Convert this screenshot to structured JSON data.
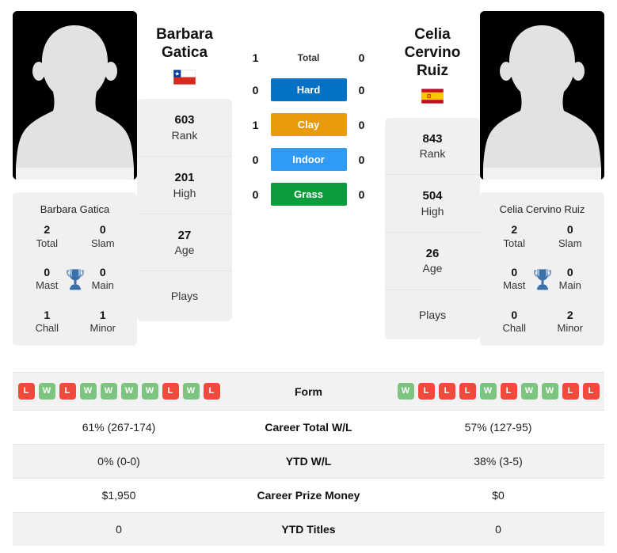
{
  "colors": {
    "hard": "#0571c4",
    "clay": "#e89b0c",
    "indoor": "#2f9bf5",
    "grass": "#0c9c3c",
    "win": "#7cc47f",
    "loss": "#ef4a3c",
    "trophy": "#3b6fa8",
    "card_bg": "#f0f0f0"
  },
  "left_player": {
    "name_line1": "Barbara",
    "name_line2": "Gatica",
    "full_name": "Barbara Gatica",
    "flag": "chile-flag-icon",
    "avatar": "player-avatar-placeholder",
    "titles": [
      {
        "value": "2",
        "label": "Total"
      },
      {
        "value": "0",
        "label": "Slam"
      },
      {
        "value": "0",
        "label": "Mast"
      },
      {
        "value": "0",
        "label": "Main"
      },
      {
        "value": "1",
        "label": "Chall"
      },
      {
        "value": "1",
        "label": "Minor"
      }
    ],
    "stats": [
      {
        "value": "603",
        "label": "Rank"
      },
      {
        "value": "201",
        "label": "High"
      },
      {
        "value": "27",
        "label": "Age"
      },
      {
        "value": "",
        "label": "Plays"
      }
    ],
    "form": [
      "L",
      "W",
      "L",
      "W",
      "W",
      "W",
      "W",
      "L",
      "W",
      "L"
    ]
  },
  "right_player": {
    "name_line1": "Celia Cervino",
    "name_line2": "Ruiz",
    "full_name": "Celia Cervino Ruiz",
    "flag": "spain-flag-icon",
    "avatar": "player-avatar-placeholder",
    "titles": [
      {
        "value": "2",
        "label": "Total"
      },
      {
        "value": "0",
        "label": "Slam"
      },
      {
        "value": "0",
        "label": "Mast"
      },
      {
        "value": "0",
        "label": "Main"
      },
      {
        "value": "0",
        "label": "Chall"
      },
      {
        "value": "2",
        "label": "Minor"
      }
    ],
    "stats": [
      {
        "value": "843",
        "label": "Rank"
      },
      {
        "value": "504",
        "label": "High"
      },
      {
        "value": "26",
        "label": "Age"
      },
      {
        "value": "",
        "label": "Plays"
      }
    ],
    "form": [
      "W",
      "L",
      "L",
      "L",
      "W",
      "L",
      "W",
      "W",
      "L",
      "L"
    ]
  },
  "head_to_head": [
    {
      "label": "Total",
      "left": "1",
      "right": "0",
      "badge": false,
      "color": ""
    },
    {
      "label": "Hard",
      "left": "0",
      "right": "0",
      "badge": true,
      "color": "#0571c4"
    },
    {
      "label": "Clay",
      "left": "1",
      "right": "0",
      "badge": true,
      "color": "#e89b0c"
    },
    {
      "label": "Indoor",
      "left": "0",
      "right": "0",
      "badge": true,
      "color": "#2f9bf5"
    },
    {
      "label": "Grass",
      "left": "0",
      "right": "0",
      "badge": true,
      "color": "#0c9c3c"
    }
  ],
  "comparison_rows": [
    {
      "label": "Form",
      "left": "",
      "right": "",
      "type": "form"
    },
    {
      "label": "Career Total W/L",
      "left": "61% (267-174)",
      "right": "57% (127-95)",
      "type": "text"
    },
    {
      "label": "YTD W/L",
      "left": "0% (0-0)",
      "right": "38% (3-5)",
      "type": "text"
    },
    {
      "label": "Career Prize Money",
      "left": "$1,950",
      "right": "$0",
      "type": "text"
    },
    {
      "label": "YTD Titles",
      "left": "0",
      "right": "0",
      "type": "text"
    }
  ]
}
